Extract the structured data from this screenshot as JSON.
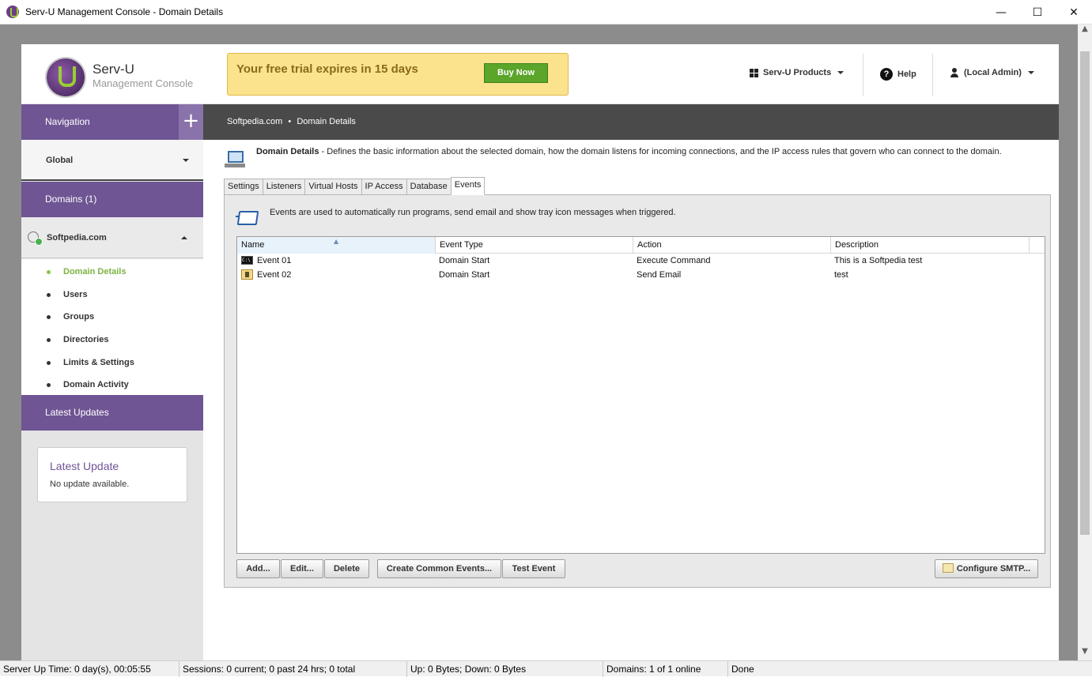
{
  "window": {
    "title": "Serv-U Management Console - Domain Details",
    "minimize": "—",
    "maximize": "☐",
    "close": "✕"
  },
  "header": {
    "brand_name": "Serv-U",
    "brand_sub": "Management Console",
    "trial_text": "Your free trial expires in 15 days",
    "buy_label": "Buy Now",
    "products_label": "Serv-U Products",
    "help_label": "Help",
    "user_label": "(Local Admin)"
  },
  "sidebar": {
    "nav_label": "Navigation",
    "nav_plus": "+",
    "global_label": "Global",
    "domains_label": "Domains (1)",
    "domain_name": "Softpedia.com",
    "items": [
      {
        "label": "Domain Details",
        "active": true
      },
      {
        "label": "Users"
      },
      {
        "label": "Groups"
      },
      {
        "label": "Directories"
      },
      {
        "label": "Limits & Settings"
      },
      {
        "label": "Domain Activity"
      }
    ],
    "updates_label": "Latest Updates",
    "update_card_title": "Latest Update",
    "update_card_body": "No update available."
  },
  "breadcrumb": {
    "domain": "Softpedia.com",
    "sep": "•",
    "page": "Domain Details"
  },
  "main": {
    "desc_title": "Domain Details",
    "desc_body": " - Defines the basic information about the selected domain, how the domain listens for incoming connections, and the IP access rules that govern who can connect to the domain.",
    "tabs": [
      "Settings",
      "Listeners",
      "Virtual Hosts",
      "IP Access",
      "Database",
      "Events"
    ],
    "active_tab": "Events",
    "events_note": "Events are used to automatically run programs, send email and show tray icon messages when triggered.",
    "columns": [
      "Name",
      "Event Type",
      "Action",
      "Description"
    ],
    "rows": [
      {
        "name": "Event 01",
        "type": "Domain Start",
        "action": "Execute Command",
        "description": "This is a Softpedia test",
        "icon": "command-icon"
      },
      {
        "name": "Event 02",
        "type": "Domain Start",
        "action": "Send Email",
        "description": "test",
        "icon": "email-icon"
      }
    ],
    "buttons": {
      "add": "Add...",
      "edit": "Edit...",
      "delete": "Delete",
      "create_common": "Create Common Events...",
      "test": "Test Event",
      "smtp": "Configure SMTP..."
    }
  },
  "status": {
    "uptime": "Server Up Time: 0 day(s), 00:05:55",
    "sessions": "Sessions: 0 current; 0 past 24 hrs; 0 total",
    "traffic": "Up: 0 Bytes; Down: 0 Bytes",
    "domains": "Domains: 1 of 1 online",
    "state": "Done"
  },
  "colors": {
    "purple": "#6f5594",
    "green": "#5aa52a",
    "trial_bg": "#fbe38d"
  }
}
